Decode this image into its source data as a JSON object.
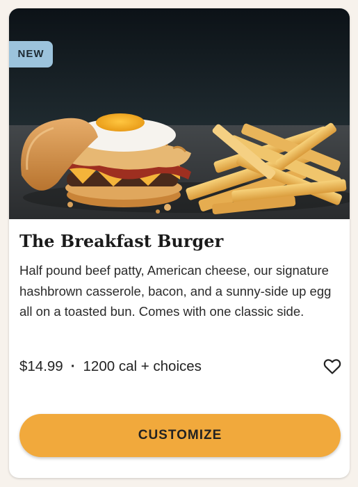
{
  "card": {
    "badge": "NEW",
    "title": "The Breakfast Burger",
    "description": "Half pound beef patty, American cheese, our signature hashbrown casserole, bacon, and a sunny-side up egg all on a toasted bun. Comes with one classic side.",
    "price": "$14.99",
    "separator": "·",
    "calories": "1200 cal + choices",
    "favorite_icon": "heart-outline-icon",
    "cta_label": "CUSTOMIZE",
    "image_alt": "Burger with fried egg, bacon and hashbrown casserole next to fries"
  },
  "colors": {
    "badge_bg": "#9cc3dc",
    "cta_bg": "#f1a93c",
    "title_text": "#1a1a1a"
  }
}
